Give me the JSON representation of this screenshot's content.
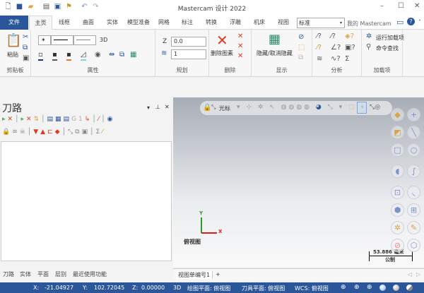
{
  "app": {
    "title": "Mastercam 设计 2022"
  },
  "window": {
    "minimize": "–",
    "maximize": "☐",
    "close": "✕"
  },
  "tabs": [
    {
      "label": "文件"
    },
    {
      "label": "主页"
    },
    {
      "label": "线框"
    },
    {
      "label": "曲面"
    },
    {
      "label": "实体"
    },
    {
      "label": "模型准备"
    },
    {
      "label": "网格"
    },
    {
      "label": "标注"
    },
    {
      "label": "转换"
    },
    {
      "label": "浮雕"
    },
    {
      "label": "机床"
    },
    {
      "label": "视图"
    }
  ],
  "style_select": "标准",
  "my_mastercam": "我的 Mastercam",
  "ribbon": {
    "clipboard": {
      "paste": "粘贴",
      "label": "剪贴板"
    },
    "attributes": {
      "label": "属性",
      "dim": "3D"
    },
    "planning": {
      "label": "规划",
      "z_label": "Z",
      "z_value": "0.0",
      "level_value": "1"
    },
    "delete": {
      "label": "删除",
      "delete_entity": "删除图素"
    },
    "display": {
      "label": "显示",
      "hide": "隐藏/取消隐藏"
    },
    "analysis": {
      "label": "分析"
    },
    "addins": {
      "label": "加载项",
      "run": "运行加载项",
      "search": "命令查找"
    }
  },
  "panel": {
    "title": "刀路",
    "tabs": [
      "刀路",
      "实体",
      "平面",
      "层别",
      "最近使用功能"
    ]
  },
  "viewport": {
    "toolbar_cursor": "光标",
    "axis_x": "X",
    "axis_y": "Y",
    "view_name": "俯视图",
    "scale_value": "53.886 毫米",
    "scale_unit": "公制",
    "view_tab": "视图单编号1",
    "add_tab": "+"
  },
  "status": {
    "x_label": "X:",
    "x": "-21.04927",
    "y_label": "Y:",
    "y": "102.72045",
    "z_label": "Z:",
    "z": "0.00000",
    "mode": "3D",
    "cplane": "绘图平面: 俯视图",
    "tplane": "刀具平面: 俯视图",
    "wcs": "WCS: 俯视图"
  },
  "colors": {
    "accent": "#2b579a",
    "delete": "#e03a1e"
  }
}
